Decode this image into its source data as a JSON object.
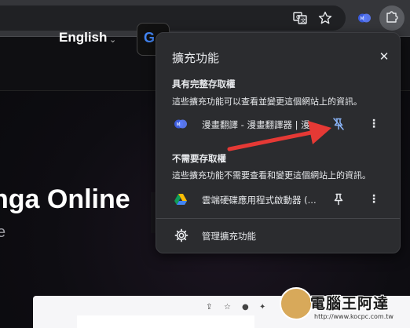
{
  "page": {
    "language": "English",
    "google_letter": "G",
    "hero_title": "nga Online",
    "hero_subtitle": "e"
  },
  "toolbar": {
    "icons": [
      "translate-icon",
      "star-icon",
      "manga-translator-extension-icon",
      "puzzle-extensions-icon"
    ]
  },
  "popup": {
    "title": "擴充功能",
    "close": "✕",
    "full_access": {
      "title": "具有完整存取權",
      "desc": "這些擴充功能可以查看並變更這個網站上的資訊。",
      "items": [
        {
          "label": "漫畫翻譯 - 漫畫翻譯器 | 漫...",
          "pinned": true
        }
      ]
    },
    "no_access": {
      "title": "不需要存取權",
      "desc": "這些擴充功能不需要查看和變更這個網站上的資訊。",
      "items": [
        {
          "label": "雲端硬碟應用程式啟動器 (...",
          "pinned": false
        }
      ]
    },
    "manage": "管理擴充功能",
    "more": "⋮"
  },
  "watermark": {
    "name": "電腦王阿達",
    "url": "http://www.kocpc.com.tw"
  },
  "colors": {
    "pin_active": "#8ab4f8",
    "arrow": "#e53935",
    "popup_bg": "#2b2c2f"
  }
}
